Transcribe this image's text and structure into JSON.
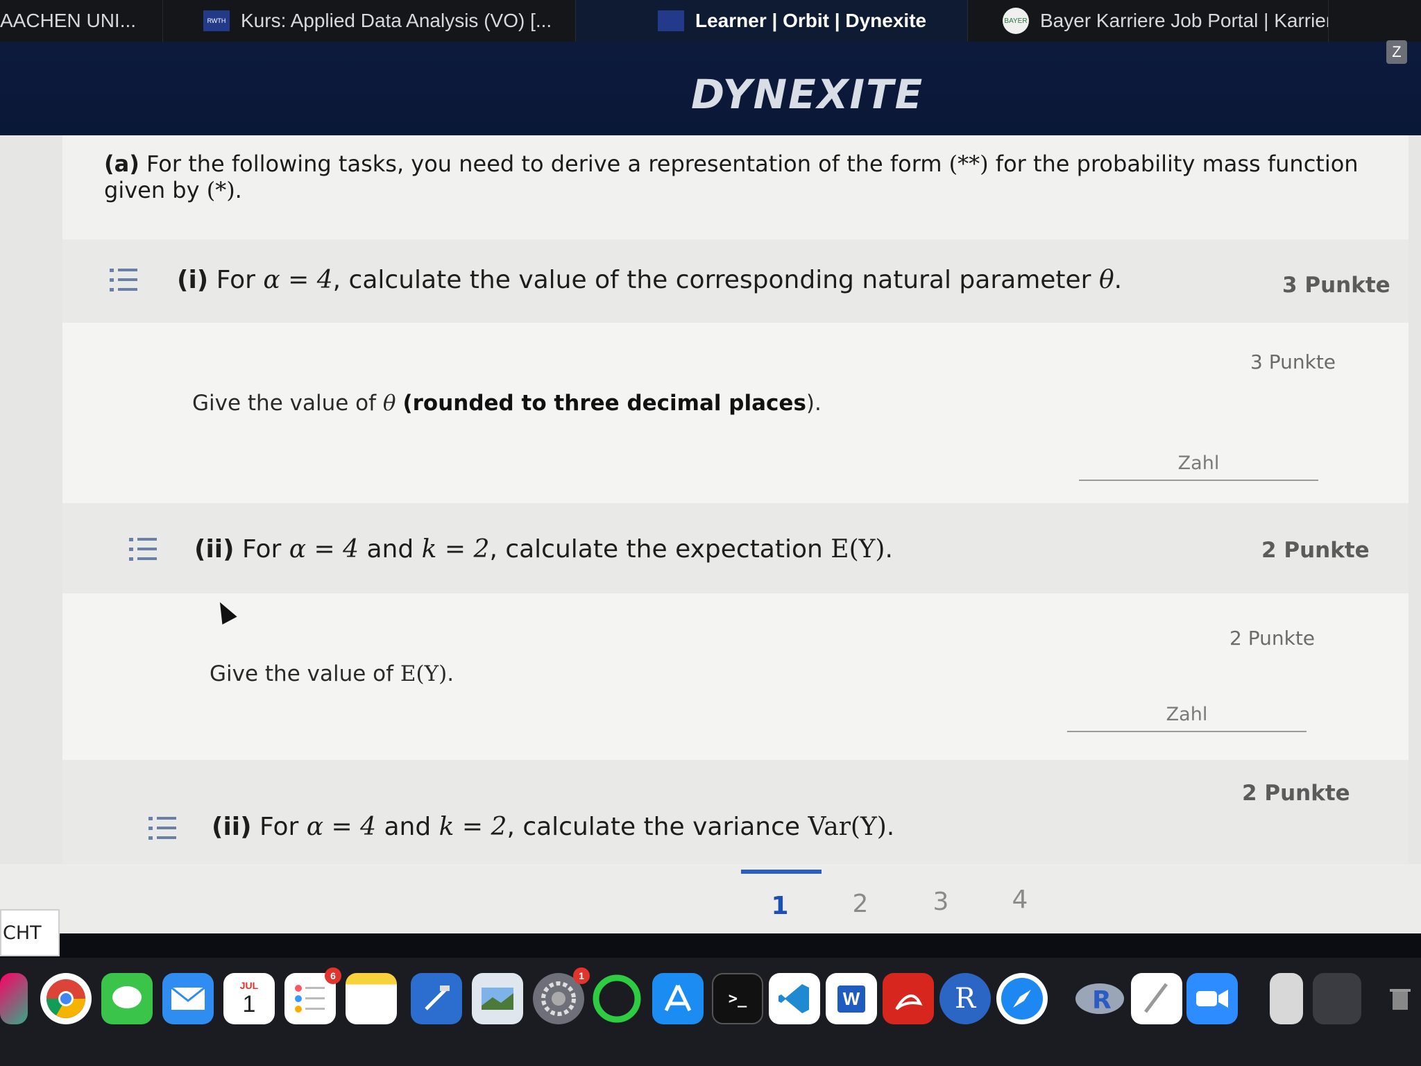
{
  "browser": {
    "tabs": [
      {
        "label": "AACHEN UNI...",
        "favicon": ""
      },
      {
        "label": "Kurs: Applied Data Analysis (VO) [...",
        "favicon": "RWTH"
      },
      {
        "label": "Learner | Orbit | Dynexite",
        "favicon": ""
      },
      {
        "label": "Bayer Karriere Job Portal | Karriere...",
        "favicon": "BAYER"
      }
    ],
    "profile_letter": "Z"
  },
  "site": {
    "logo": "DYNEXITE"
  },
  "task": {
    "label": "(a)",
    "intro_text": "For the following tasks, you need to derive a representation of the form",
    "intro_form": "(**)",
    "intro_mid": "for the probability mass function given by",
    "intro_given": "(*)",
    "intro_end": "."
  },
  "subtasks": [
    {
      "label": "(i)",
      "text_before": "For",
      "math1": "α = 4",
      "text_mid": ", calculate the value of the corresponding natural parameter",
      "math2": "θ",
      "text_end": ".",
      "points": "3 Punkte",
      "answer": {
        "text_before": "Give the value of",
        "math": "θ",
        "bold": "(rounded to three decimal places",
        "text_end": ").",
        "points": "3 Punkte",
        "placeholder": "Zahl"
      }
    },
    {
      "label": "(ii)",
      "text_before": "For",
      "math1": "α = 4",
      "text_and": "and",
      "math2": "k = 2",
      "text_mid": ", calculate the expectation",
      "math3": "E(Y)",
      "text_end": ".",
      "points": "2 Punkte",
      "answer": {
        "text_before": "Give the value of",
        "math": "E(Y)",
        "text_end": ".",
        "points": "2 Punkte",
        "placeholder": "Zahl"
      }
    },
    {
      "label": "(ii)",
      "text_before": "For",
      "math1": "α = 4",
      "text_and": "and",
      "math2": "k = 2",
      "text_mid": ", calculate the variance",
      "math3": "Var(Y)",
      "text_end": ".",
      "points": "2 Punkte"
    }
  ],
  "pager": {
    "pages": [
      "1",
      "2",
      "3",
      "4"
    ],
    "active": "1",
    "left_button": "CHT"
  },
  "dock": {
    "calendar_month": "JUL",
    "calendar_day": "1",
    "reminders_badge": "6",
    "settings_badge": "1",
    "word_letter": "W",
    "r_letter": "R"
  },
  "colors": {
    "header_bg": "#0d1a3c",
    "accent": "#2a5cc4",
    "page_bg": "#f1f1ef"
  }
}
